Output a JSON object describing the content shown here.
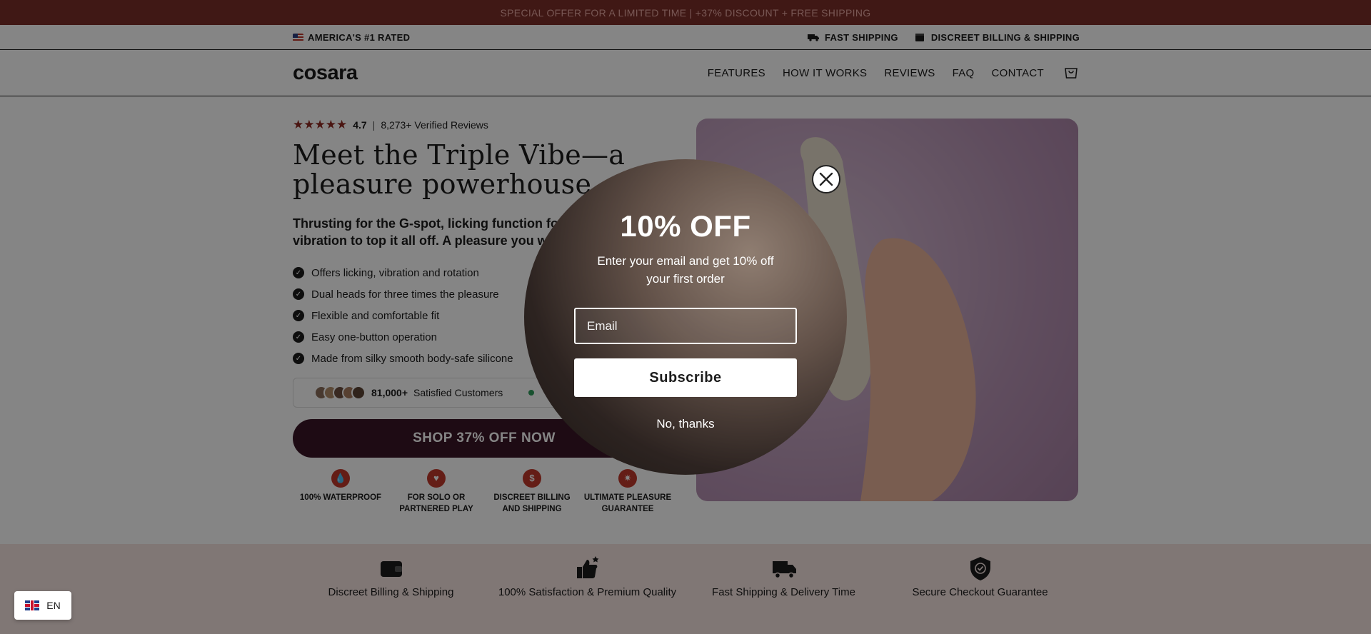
{
  "announcement": "SPECIAL OFFER FOR A LIMITED TIME | +37% DISCOUNT + FREE SHIPPING",
  "top_strip": {
    "left": "AMERICA'S #1 RATED",
    "right": [
      "FAST SHIPPING",
      "DISCREET BILLING & SHIPPING"
    ]
  },
  "header": {
    "logo": "cosara",
    "nav": [
      "FEATURES",
      "HOW IT WORKS",
      "REVIEWS",
      "FAQ",
      "CONTACT"
    ]
  },
  "hero": {
    "rating_value": "4.7",
    "rating_count": "8,273+ Verified Reviews",
    "headline": "Meet the Triple Vibe—a pleasure powerhouse.",
    "subheading": "Thrusting for the G-spot, licking function for the clit, and vibration to top it all off. A pleasure you will",
    "bullets": [
      "Offers licking, vibration and rotation",
      "Dual heads for three times the pleasure",
      "Flexible and comfortable fit",
      "Easy one-button operation",
      "Made from silky smooth body-safe silicone"
    ],
    "social_count": "81,000+",
    "social_label": "Satisfied Customers",
    "cta": "SHOP 37% OFF NOW",
    "badges": [
      "100% WATERPROOF",
      "FOR SOLO OR PARTNERED PLAY",
      "DISCREET BILLING AND SHIPPING",
      "ULTIMATE PLEASURE GUARANTEE"
    ]
  },
  "trust": [
    "Discreet Billing & Shipping",
    "100% Satisfaction & Premium Quality",
    "Fast Shipping & Delivery Time",
    "Secure Checkout Guarantee"
  ],
  "language": "EN",
  "popup": {
    "title": "10% OFF",
    "text": "Enter your email and get 10% off your first order",
    "email_placeholder": "Email",
    "subscribe": "Subscribe",
    "decline": "No, thanks"
  },
  "colors": {
    "announcement_bg": "#7b2f2a",
    "cta_bg": "#3a1628",
    "accent": "#8e2a22",
    "trust_bg": "#f5e4e0"
  }
}
